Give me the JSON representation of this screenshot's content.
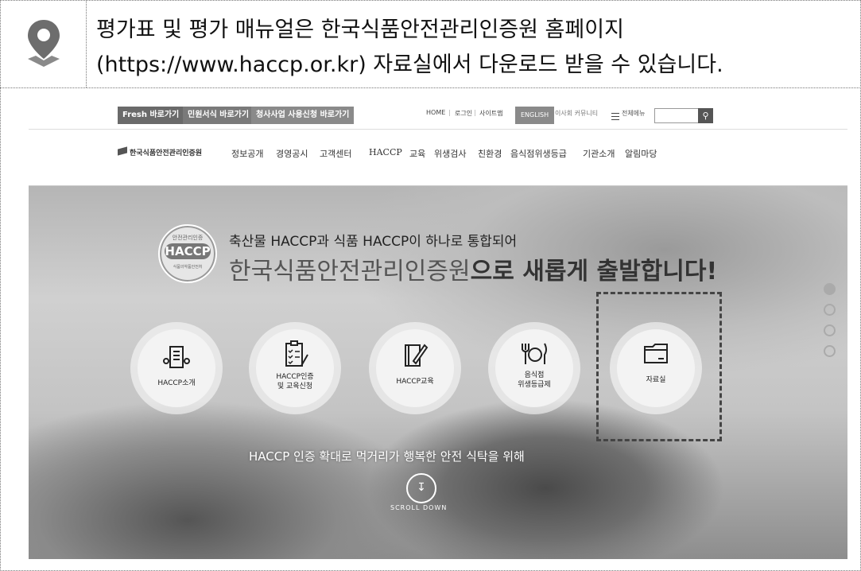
{
  "note": {
    "line1": "평가표 및 평가 매뉴얼은 한국식품안전관리인증원 홈페이지",
    "line2": "(https://www.haccp.or.kr) 자료실에서 다운로드 받을 수 있습니다."
  },
  "topbar": {
    "tabs": [
      "Fresh 바로가기",
      "민원서식 바로가기",
      "청사사업 사용신청 바로가기"
    ],
    "links": [
      "HOME",
      "로그인",
      "사이트맵"
    ],
    "english": "ENGLISH",
    "board": "이사회 커뮤니티",
    "all_menu": "전체메뉴",
    "search_icon": "search-icon"
  },
  "navbar": {
    "logo": "한국식품안전관리인증원",
    "items": [
      "정보공개",
      "경영공시",
      "고객센터",
      "HACCP",
      "교육",
      "위생검사",
      "친환경",
      "음식점위생등급",
      "기관소개",
      "알림마당"
    ]
  },
  "hero": {
    "badge_top": "안전관리인증",
    "badge_main": "HACCP",
    "badge_bottom": "식품의약품안전처",
    "subtitle": "축산물 HACCP과 식품 HACCP이 하나로 통합되어",
    "title_a": "한국식품안전관리인증원",
    "title_b": "으로 새롭게 출발합니다!",
    "tagline": "HACCP 인증 확대로 먹거리가 행복한 안전 식탁을 위해",
    "scroll": "SCROLL DOWN",
    "quick": [
      {
        "label": "HACCP소개",
        "icon": "document-icon"
      },
      {
        "label1": "HACCP인증",
        "label2": "및 교육신청",
        "icon": "clipboard-icon"
      },
      {
        "label": "HACCP교육",
        "icon": "book-pen-icon"
      },
      {
        "label1": "음식점",
        "label2": "위생등급제",
        "icon": "dining-icon"
      },
      {
        "label": "자료실",
        "icon": "folder-icon"
      }
    ]
  }
}
